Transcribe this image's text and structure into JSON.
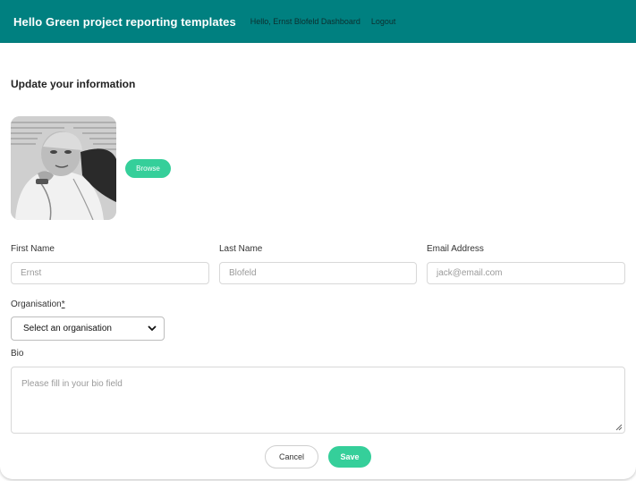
{
  "header": {
    "brand": "Hello Green project reporting templates",
    "nav": {
      "greeting": "Hello, Ernst Blofeld",
      "dashboard": "Dashboard",
      "logout": "Logout"
    }
  },
  "form": {
    "title": "Update your information",
    "browse_label": "Browse",
    "first_name": {
      "label": "First Name",
      "placeholder": "Ernst"
    },
    "last_name": {
      "label": "Last Name",
      "placeholder": "Blofeld"
    },
    "email": {
      "label": "Email Address",
      "placeholder": "jack@email.com"
    },
    "organisation": {
      "label": "Organisation",
      "required_mark": "*",
      "selected": "Select an organisation"
    },
    "bio": {
      "label": "Bio",
      "placeholder": "Please fill in your bio field"
    },
    "cancel_label": "Cancel",
    "save_label": "Save"
  },
  "colors": {
    "header_bg": "#008080",
    "accent": "#35cf9a"
  },
  "icons": {
    "select_arrow": "chevron-down-icon",
    "textarea_resize": "resize-handle-icon"
  }
}
